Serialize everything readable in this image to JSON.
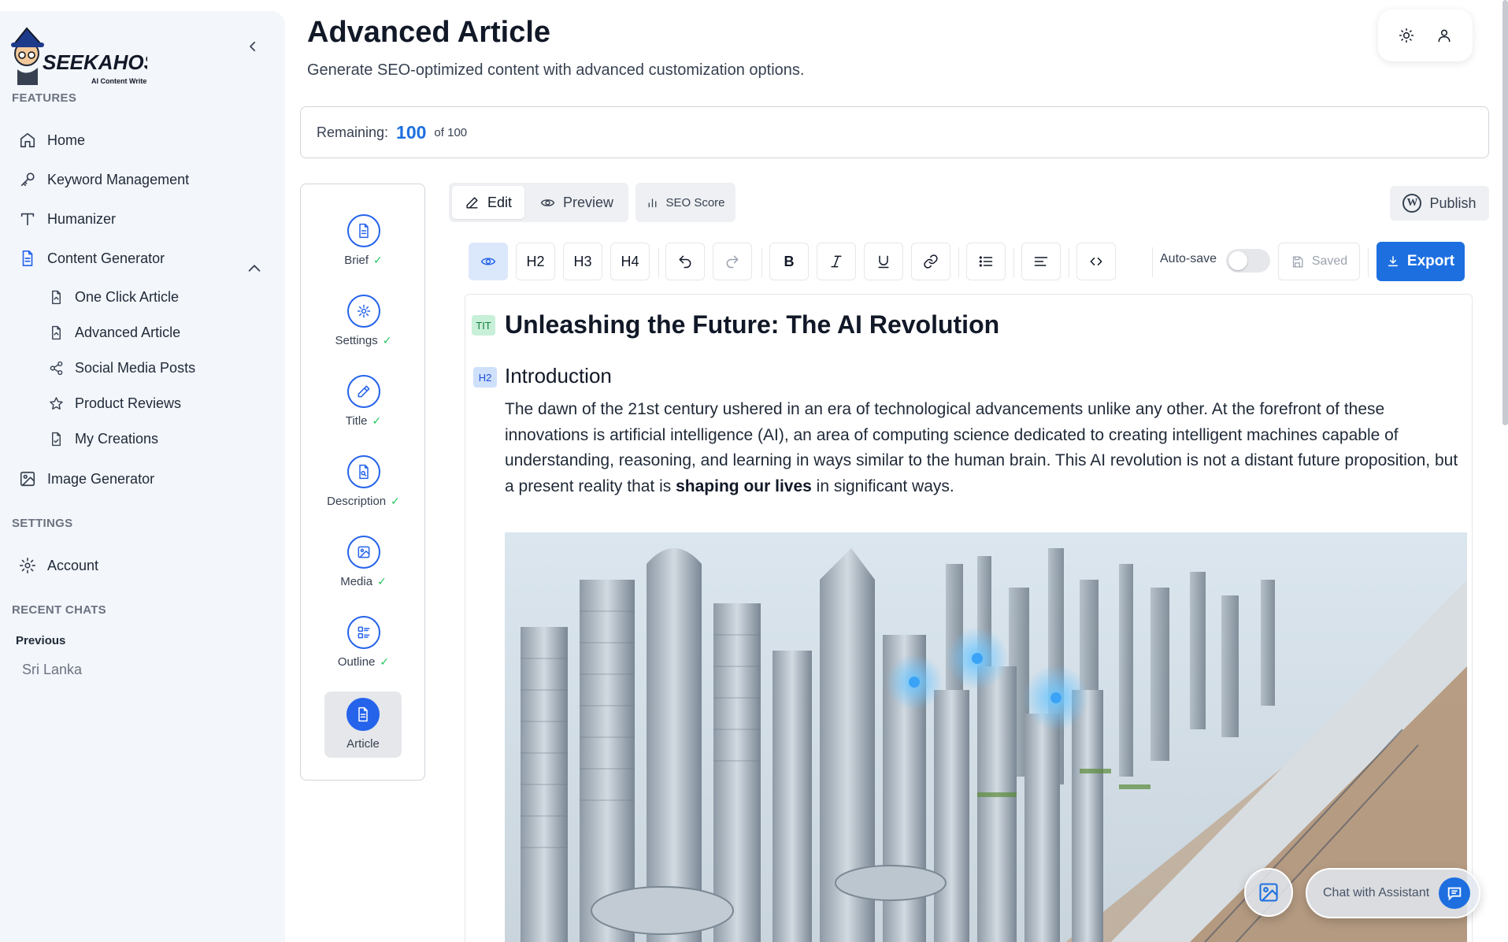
{
  "sidebar": {
    "logo_text": "SEEKAHOST",
    "logo_sub": "AI Content Writer",
    "features_label": "FEATURES",
    "items": [
      {
        "label": "Home",
        "icon": "home-icon"
      },
      {
        "label": "Keyword Management",
        "icon": "key-icon"
      },
      {
        "label": "Humanizer",
        "icon": "type-icon"
      },
      {
        "label": "Content Generator",
        "icon": "file-icon"
      },
      {
        "label": "Image Generator",
        "icon": "image-icon"
      }
    ],
    "sub_items": [
      {
        "label": "One Click Article",
        "icon": "file-icon"
      },
      {
        "label": "Advanced Article",
        "icon": "file-icon"
      },
      {
        "label": "Social Media Posts",
        "icon": "share-icon"
      },
      {
        "label": "Product Reviews",
        "icon": "star-icon"
      },
      {
        "label": "My Creations",
        "icon": "file-icon"
      }
    ],
    "settings_label": "SETTINGS",
    "account_label": "Account",
    "recent_label": "RECENT CHATS",
    "previous_label": "Previous",
    "recent_chats": [
      "Sri Lanka"
    ]
  },
  "header": {
    "title": "Advanced Article",
    "subtitle": "Generate SEO-optimized content with advanced customization options."
  },
  "remaining": {
    "label": "Remaining:",
    "value": "100",
    "of": "of 100"
  },
  "steps": [
    {
      "label": "Brief",
      "done": true,
      "icon": "file-icon"
    },
    {
      "label": "Settings",
      "done": true,
      "icon": "gear-icon"
    },
    {
      "label": "Title",
      "done": true,
      "icon": "pencil-icon"
    },
    {
      "label": "Description",
      "done": true,
      "icon": "file-search-icon"
    },
    {
      "label": "Media",
      "done": true,
      "icon": "image-icon"
    },
    {
      "label": "Outline",
      "done": true,
      "icon": "outline-icon"
    },
    {
      "label": "Article",
      "done": false,
      "icon": "file-icon"
    }
  ],
  "tabs": {
    "edit": "Edit",
    "preview": "Preview",
    "seo": "SEO Score",
    "publish": "Publish"
  },
  "toolbar": {
    "h2": "H2",
    "h3": "H3",
    "h4": "H4",
    "bold": "B",
    "autosave_label": "Auto-save",
    "autosave_on": false,
    "saved_label": "Saved",
    "export_label": "Export"
  },
  "article": {
    "title_badge": "TIT",
    "title": "Unleashing the Future: The AI Revolution",
    "h2_badge": "H2",
    "h2": "Introduction",
    "para_before": "The dawn of the 21st century ushered in an era of technological advancements unlike any other. At the forefront of these innovations is artificial intelligence (AI), an area of computing science dedicated to creating intelligent machines capable of understanding, reasoning, and learning in ways similar to the human brain. This AI revolution is not a distant future proposition, but a present reality that is ",
    "para_bold": "shaping our lives",
    "para_after": " in significant ways."
  },
  "chat": {
    "label": "Chat with Assistant"
  },
  "colors": {
    "accent": "#1d6fe0",
    "check": "#22c55e",
    "sidebar_bg": "#f3f6fb"
  }
}
